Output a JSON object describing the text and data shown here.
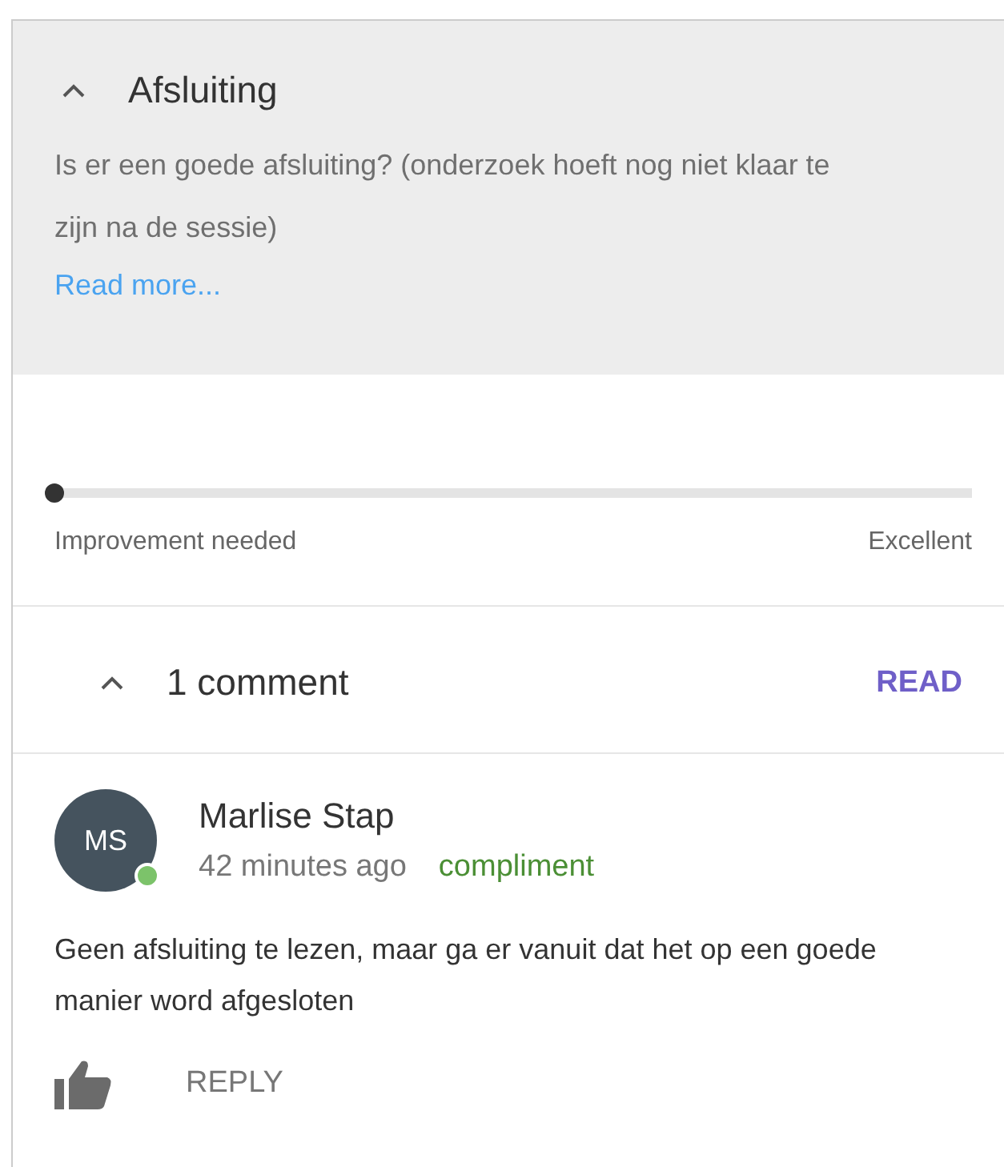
{
  "section": {
    "title": "Afsluiting",
    "expanded": true,
    "description": "Is er een goede afsluiting? (onderzoek hoeft nog niet klaar te zijn na de sessie)",
    "read_more": "Read more..."
  },
  "rating": {
    "level": 0,
    "min_label": "Improvement needed",
    "max_label": "Excellent"
  },
  "comments_header": {
    "label": "1 comment",
    "expanded": true,
    "action": "READ"
  },
  "comments": [
    {
      "initials": "MS",
      "online": true,
      "author": "Marlise Stap",
      "time": "42 minutes ago",
      "tag": "compliment",
      "text": "Geen afsluiting te lezen, maar ga er vanuit dat het op een goede manier word afgesloten",
      "reply": "REPLY"
    }
  ]
}
